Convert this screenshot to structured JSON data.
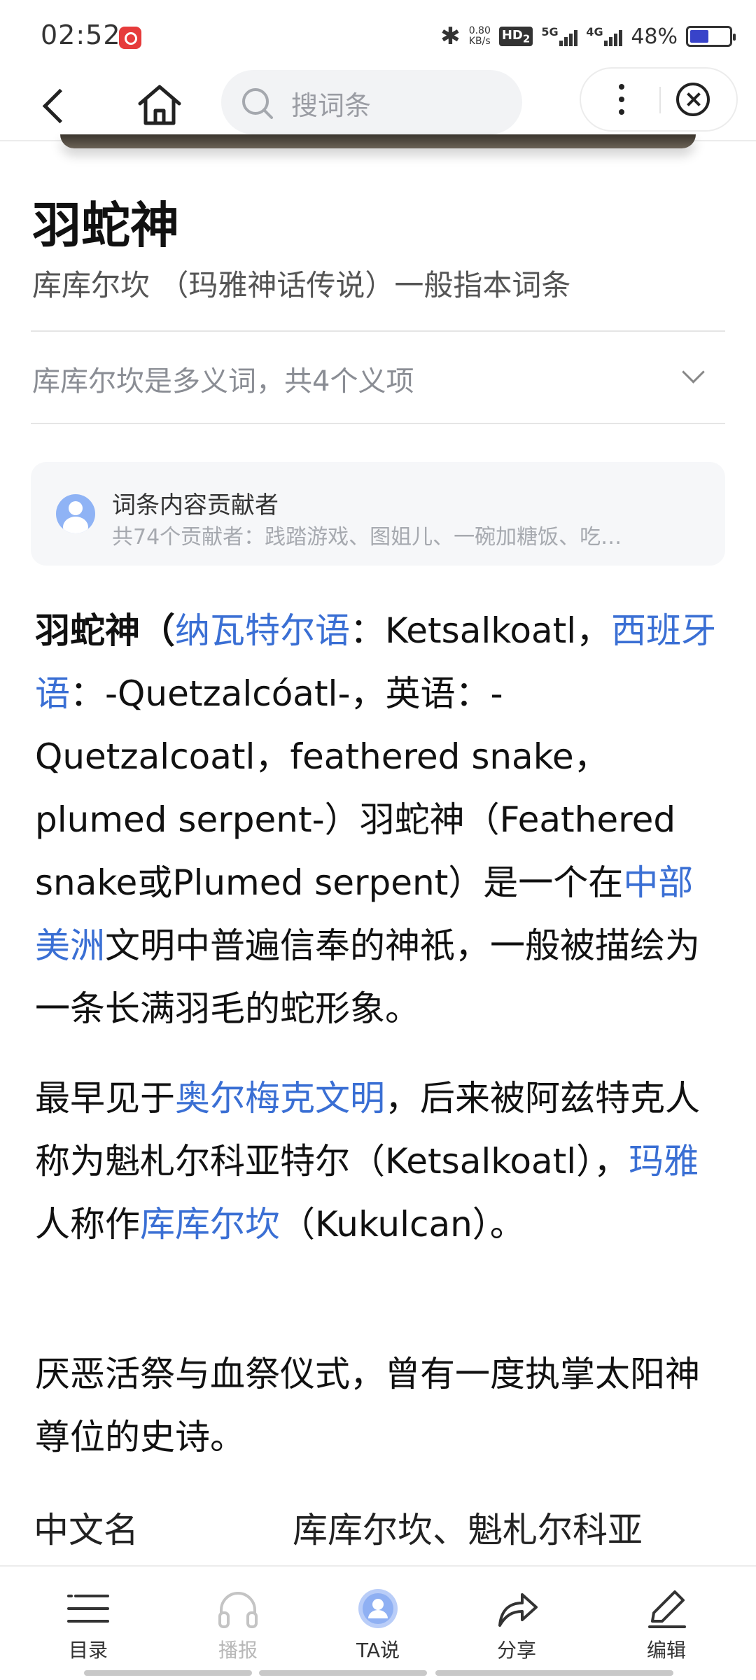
{
  "status_bar": {
    "time": "02:52",
    "net_speed_value": "0.80",
    "net_speed_unit": "KB/s",
    "hd_label": "HD",
    "hd_sub": "2",
    "signal_1_label": "5G",
    "signal_2_label": "4G",
    "battery_percent_text": "48%",
    "battery_level": 0.48
  },
  "nav": {
    "search_placeholder": "搜词条"
  },
  "entry": {
    "title": "羽蛇神",
    "subtitle": "库库尔坎 （玛雅神话传说）一般指本词条",
    "polysemy_notice": "库库尔坎是多义词，共4个义项"
  },
  "contributors": {
    "title": "词条内容贡献者",
    "names": "共74个贡献者：践踏游戏、图姐儿、一碗加糖饭、吃…"
  },
  "paragraphs": {
    "p1": {
      "t1": "羽蛇神（",
      "l1": "纳瓦特尔语",
      "t2": "：Ketsalkoatl，",
      "l2": "西班牙语",
      "t3": "：-Quetzalcóatl-，英语：-Quetzalcoatl，feathered snake，plumed serpent-）羽蛇神（Feathered snake或Plumed serpent）是一个在",
      "l3": "中部美洲",
      "t4": "文明中普遍信奉的神祇，一般被描绘为一条长满羽毛的蛇形象。"
    },
    "p2": {
      "t1": "最早见于",
      "l1": "奥尔梅克文明",
      "t2": "，后来被阿兹特克人称为魁札尔科亚特尔（Ketsalkoatl），",
      "l2": "玛雅",
      "t3": "人称作",
      "l3": "库库尔坎",
      "t4": "（Kukulcan）。"
    },
    "p3": {
      "t1": "厌恶活祭与血祭仪式，曾有一度执掌太阳神尊位的史诗。"
    }
  },
  "info": {
    "key": "中文名",
    "value": "库库尔坎、魁札尔科亚"
  },
  "toolbar": {
    "items": [
      {
        "label": "目录",
        "icon": "menu-list-icon"
      },
      {
        "label": "播报",
        "icon": "headphones-icon"
      },
      {
        "label": "TA说",
        "icon": "user-avatar-icon"
      },
      {
        "label": "分享",
        "icon": "share-arrow-icon"
      },
      {
        "label": "编辑",
        "icon": "pencil-icon"
      }
    ]
  },
  "colors": {
    "link": "#3a6fd4",
    "battery_fill": "#3843c9"
  }
}
